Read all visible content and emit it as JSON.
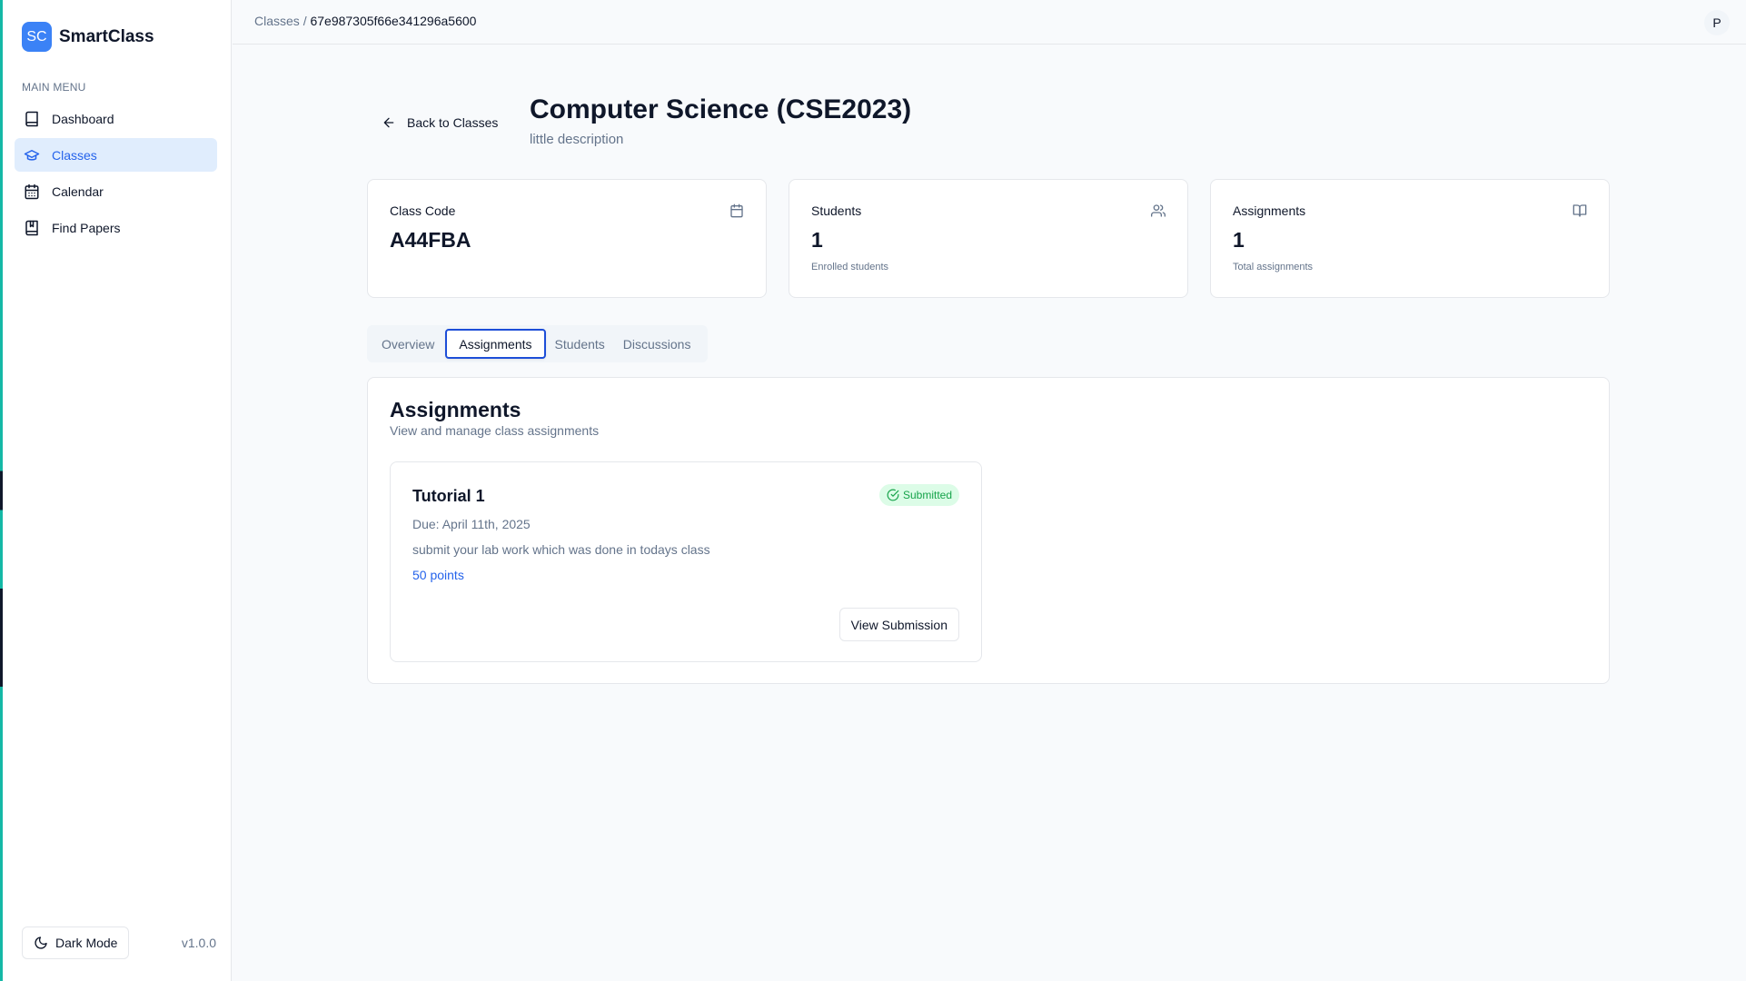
{
  "brand": {
    "logo_text": "SC",
    "name": "SmartClass",
    "accent": "#3b82f6"
  },
  "sidebar": {
    "menu_title": "MAIN MENU",
    "items": [
      {
        "label": "Dashboard",
        "icon": "book-icon"
      },
      {
        "label": "Classes",
        "icon": "graduation-cap-icon",
        "active": true
      },
      {
        "label": "Calendar",
        "icon": "calendar-icon"
      },
      {
        "label": "Find Papers",
        "icon": "bookmark-book-icon"
      }
    ],
    "dark_mode_label": "Dark Mode",
    "version": "v1.0.0"
  },
  "topbar": {
    "breadcrumb_parent": "Classes",
    "breadcrumb_sep": "/",
    "breadcrumb_current": "67e987305f66e341296a5600",
    "avatar_initial": "P"
  },
  "header": {
    "back_label": "Back to Classes",
    "title": "Computer Science (CSE2023)",
    "description": "little description"
  },
  "stats": [
    {
      "label": "Class Code",
      "value": "A44FBA",
      "caption": "",
      "icon": "calendar-icon"
    },
    {
      "label": "Students",
      "value": "1",
      "caption": "Enrolled students",
      "icon": "users-icon"
    },
    {
      "label": "Assignments",
      "value": "1",
      "caption": "Total assignments",
      "icon": "open-book-icon"
    }
  ],
  "tabs": [
    {
      "label": "Overview"
    },
    {
      "label": "Assignments",
      "active": true
    },
    {
      "label": "Students"
    },
    {
      "label": "Discussions"
    }
  ],
  "assignments_panel": {
    "title": "Assignments",
    "subtitle": "View and manage class assignments",
    "items": [
      {
        "title": "Tutorial 1",
        "status": "Submitted",
        "due": "Due: April 11th, 2025",
        "description": "submit your lab work which was done in todays class",
        "points": "50 points",
        "action_label": "View Submission"
      }
    ]
  },
  "colors": {
    "status_green": "#16a34a",
    "link_blue": "#2563eb",
    "active_nav_bg": "#e0edfd"
  }
}
